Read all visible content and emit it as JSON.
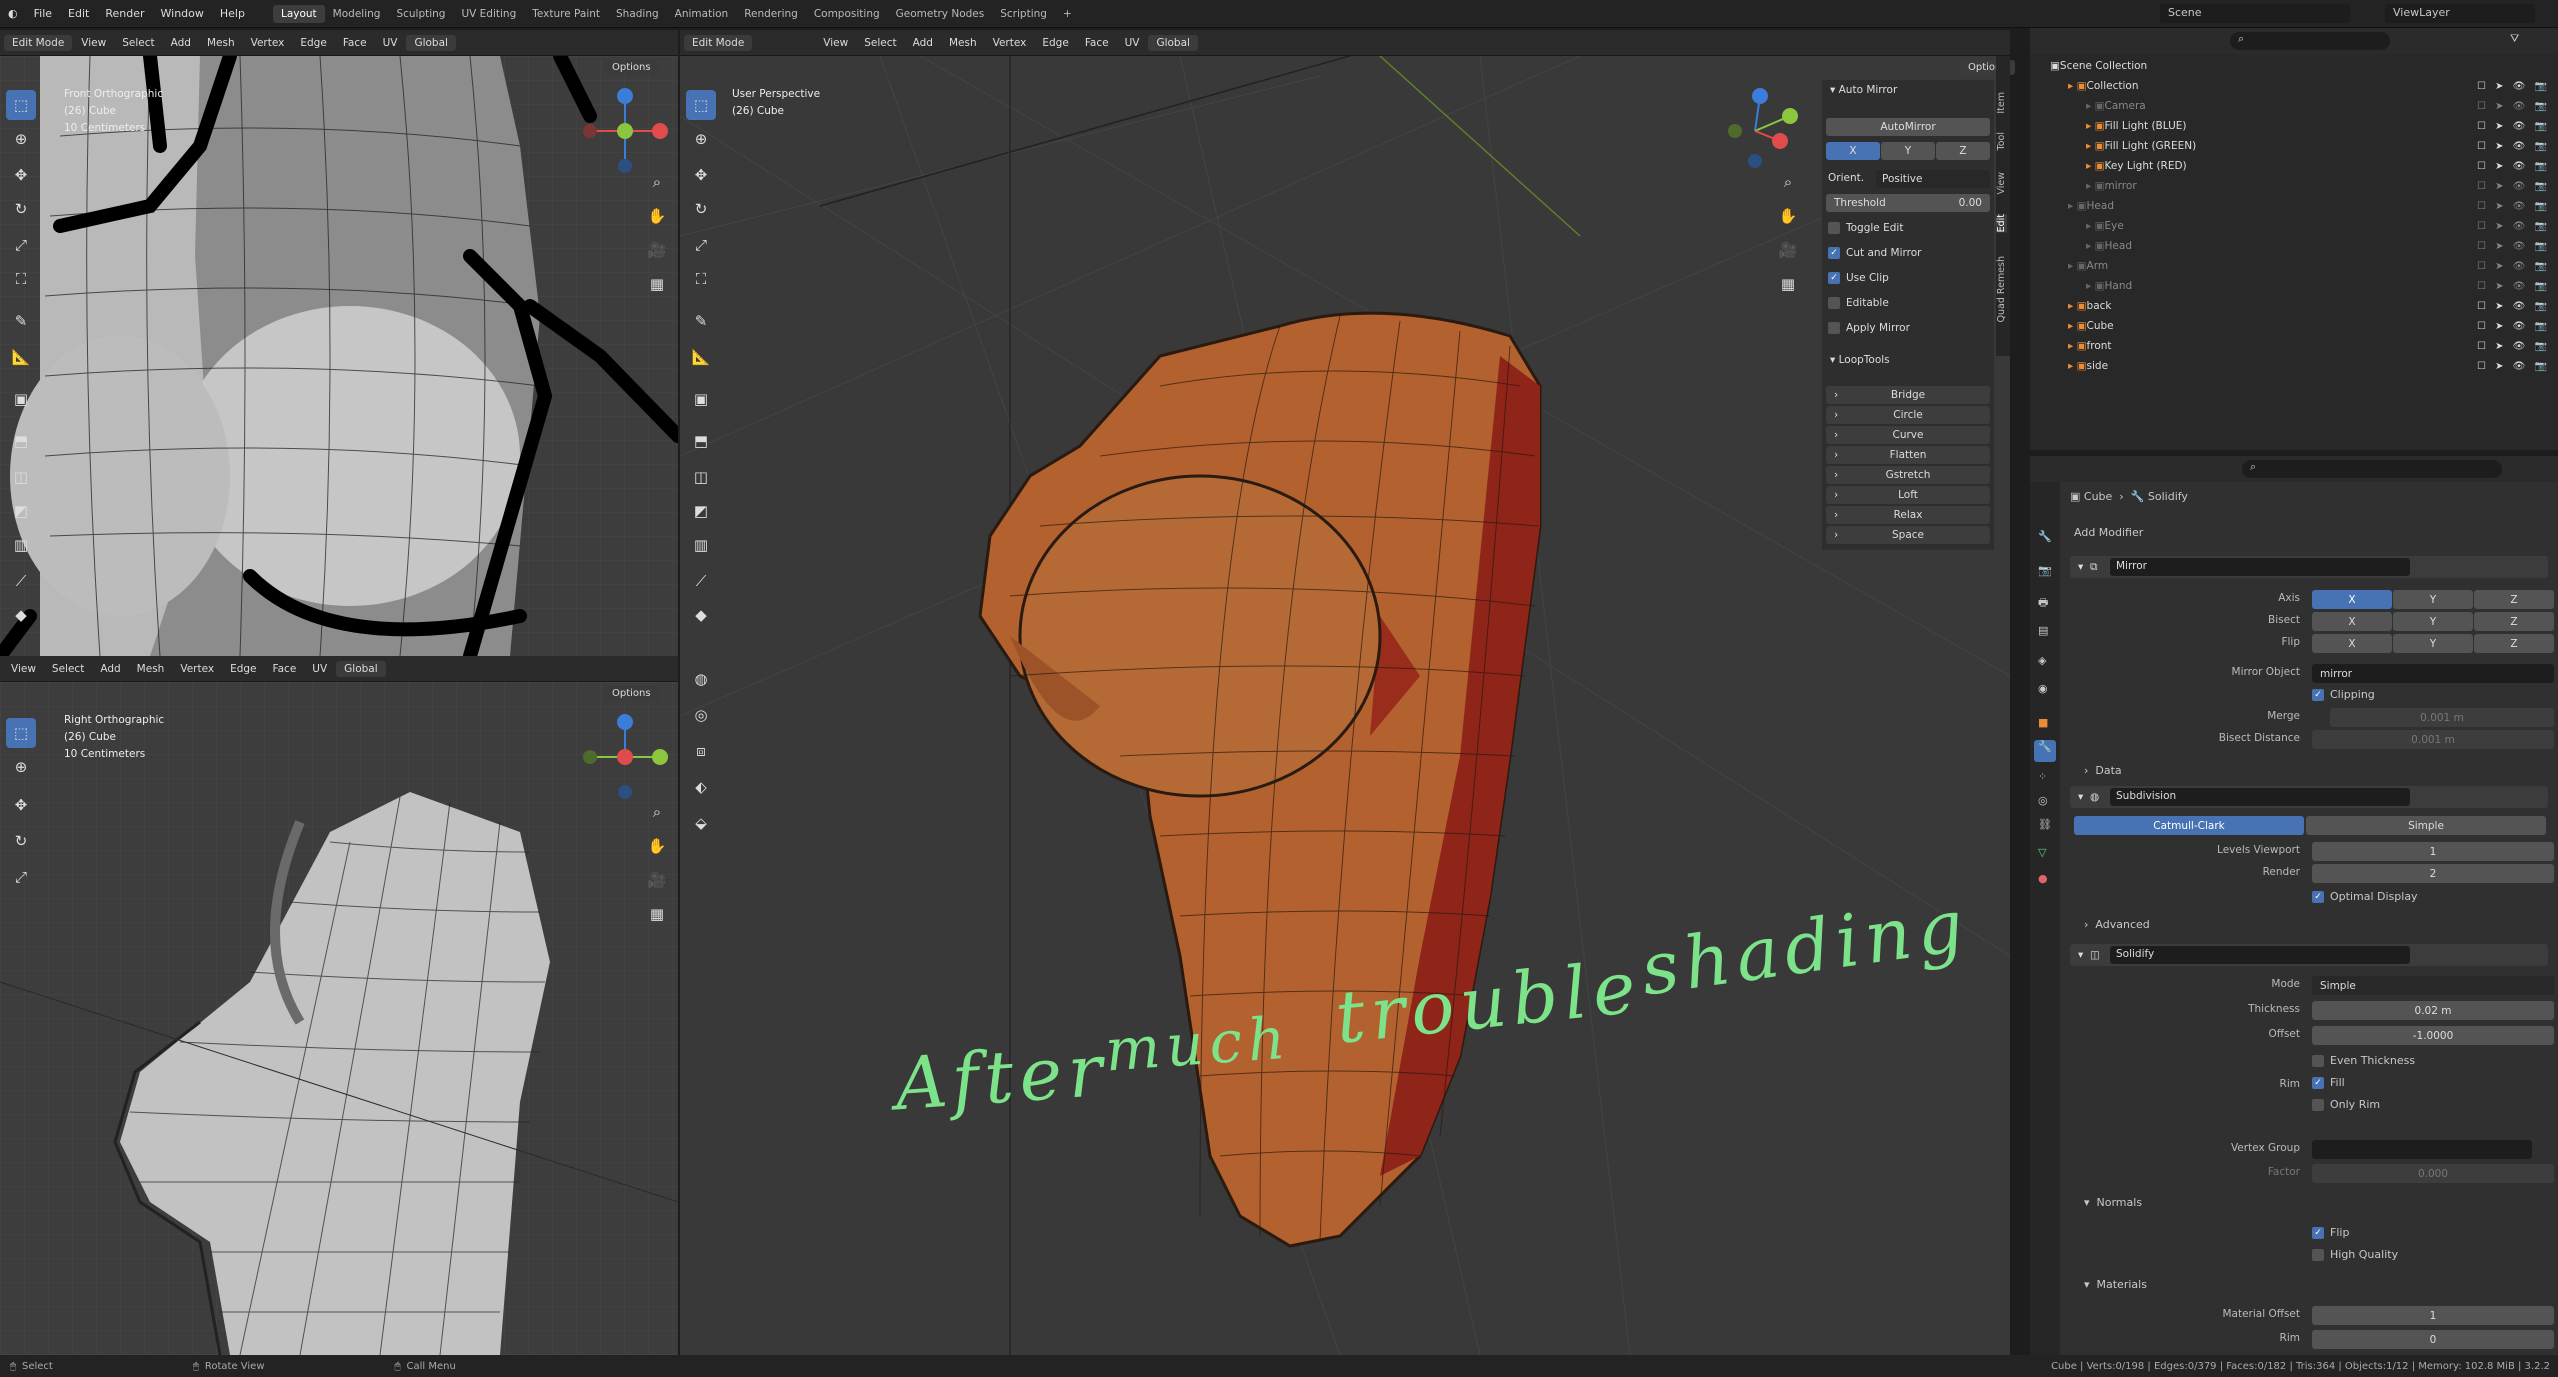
{
  "topbar": {
    "menus": [
      "File",
      "Edit",
      "Render",
      "Window",
      "Help"
    ],
    "workspaces": [
      "Layout",
      "Modeling",
      "Sculpting",
      "UV Editing",
      "Texture Paint",
      "Shading",
      "Animation",
      "Rendering",
      "Compositing",
      "Geometry Nodes",
      "Scripting",
      "+"
    ],
    "scene": "Scene",
    "view_layer": "ViewLayer"
  },
  "left_header": {
    "mode": "Edit Mode",
    "menus": [
      "View",
      "Select",
      "Add",
      "Mesh",
      "Vertex",
      "Edge",
      "Face",
      "UV"
    ],
    "orientation": "Global",
    "options": "Options"
  },
  "front_view": {
    "title": "Front Orthographic",
    "object": "(26) Cube",
    "scale": "10 Centimeters"
  },
  "right_view": {
    "title": "Right Orthographic",
    "object": "(26) Cube",
    "scale": "10 Centimeters"
  },
  "main_header": {
    "mode": "Edit Mode",
    "menus": [
      "View",
      "Select",
      "Add",
      "Mesh",
      "Vertex",
      "Edge",
      "Face",
      "UV"
    ],
    "orientation": "Global",
    "options": "Options"
  },
  "main_view": {
    "title": "User Perspective",
    "object": "(26) Cube"
  },
  "xyz": [
    "X",
    "Y",
    "Z"
  ],
  "auto_mirror": {
    "header": "Auto Mirror",
    "button": "AutoMirror",
    "axes": [
      "X",
      "Y",
      "Z"
    ],
    "orient_label": "Orient.",
    "orient_value": "Positive",
    "threshold_label": "Threshold",
    "threshold_value": "0.00",
    "toggle_edit": "Toggle Edit",
    "cut_and_mirror": "Cut and Mirror",
    "use_clip": "Use Clip",
    "editable": "Editable",
    "apply_mirror": "Apply Mirror"
  },
  "looptools": {
    "header": "LoopTools",
    "items": [
      "Bridge",
      "Circle",
      "Curve",
      "Flatten",
      "Gstretch",
      "Loft",
      "Relax",
      "Space"
    ]
  },
  "side_tabs": [
    "Item",
    "Tool",
    "View",
    "Edit",
    "Quad Remesh"
  ],
  "outliner": {
    "root": "Scene Collection",
    "items": [
      {
        "name": "Collection",
        "indent": 1
      },
      {
        "name": "Camera",
        "indent": 2,
        "dim": true
      },
      {
        "name": "Fill Light (BLUE)",
        "indent": 2
      },
      {
        "name": "Fill Light (GREEN)",
        "indent": 2
      },
      {
        "name": "Key Light (RED)",
        "indent": 2
      },
      {
        "name": "mirror",
        "indent": 2,
        "dim": true
      },
      {
        "name": "Head",
        "indent": 1,
        "dim": true
      },
      {
        "name": "Eye",
        "indent": 2,
        "dim": true
      },
      {
        "name": "Head",
        "indent": 2,
        "dim": true
      },
      {
        "name": "Arm",
        "indent": 1,
        "dim": true
      },
      {
        "name": "Hand",
        "indent": 2,
        "dim": true
      },
      {
        "name": "back",
        "indent": 1
      },
      {
        "name": "Cube",
        "indent": 1
      },
      {
        "name": "front",
        "indent": 1
      },
      {
        "name": "side",
        "indent": 1
      }
    ]
  },
  "properties": {
    "breadcrumb_object": "Cube",
    "breadcrumb_mod": "Solidify",
    "add_modifier": "Add Modifier",
    "mirror": {
      "name": "Mirror",
      "axis": "Axis",
      "bisect": "Bisect",
      "flip": "Flip",
      "mirror_object_label": "Mirror Object",
      "mirror_object": "mirror",
      "clipping": "Clipping",
      "merge": "Merge",
      "merge_val": "0.001 m",
      "bisect_distance": "Bisect Distance",
      "bisect_val": "0.001 m",
      "data": "Data"
    },
    "subdivision": {
      "name": "Subdivision",
      "catmull": "Catmull-Clark",
      "simple": "Simple",
      "levels_label": "Levels Viewport",
      "levels": "1",
      "render_label": "Render",
      "render": "2",
      "optimal": "Optimal Display",
      "advanced": "Advanced"
    },
    "solidify": {
      "name": "Solidify",
      "mode_label": "Mode",
      "mode": "Simple",
      "thickness_label": "Thickness",
      "thickness": "0.02 m",
      "offset_label": "Offset",
      "offset": "-1.0000",
      "even": "Even Thickness",
      "rim_label": "Rim",
      "fill": "Fill",
      "only_rim": "Only Rim",
      "vgroup_label": "Vertex Group",
      "factor_label": "Factor",
      "factor": "0.000",
      "normals": "Normals",
      "flip": "Flip",
      "high_quality": "High Quality",
      "materials": "Materials",
      "mat_offset_label": "Material Offset",
      "mat_offset": "1",
      "rim_mat_label": "Rim",
      "rim_mat": "0"
    }
  },
  "status": {
    "select": "Select",
    "rotate": "Rotate View",
    "call_menu": "Call Menu",
    "stats": "Cube | Verts:0/198 | Edges:0/379 | Faces:0/182 | Tris:364 | Objects:1/12 | Memory: 102.8 MiB | 3.2.2"
  },
  "handwriting": {
    "w1": "After",
    "w2": "much",
    "w3": "trouble",
    "w4": "shading"
  },
  "colors": {
    "accent": "#4772b3",
    "mesh": "#b3622f",
    "handwriting": "#7de38a"
  }
}
